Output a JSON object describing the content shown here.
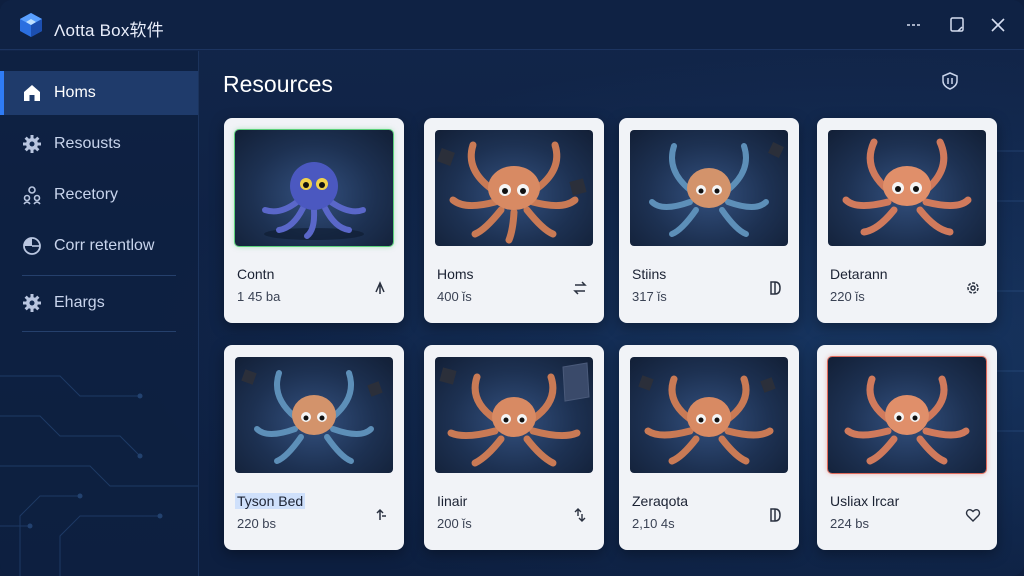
{
  "app": {
    "title": "Λotta Box软件",
    "accent": "#2f7cf6"
  },
  "sidebar": {
    "items": [
      {
        "label": "Homs",
        "icon": "home-icon",
        "active": true
      },
      {
        "label": "Resousts",
        "icon": "gear-icon",
        "active": false
      },
      {
        "label": "Recetory",
        "icon": "users-icon",
        "active": false
      },
      {
        "label": "Corr retentlow",
        "icon": "pie-chart-icon",
        "active": false
      },
      {
        "label": "Ehargs",
        "icon": "gear-icon",
        "active": false
      }
    ]
  },
  "main": {
    "title": "Resources",
    "header_icon": "info-shield-icon",
    "cards": [
      {
        "name": "Contn",
        "size": "1 45 ba",
        "action_icon": "arrow-up-icon",
        "octopus": "blue"
      },
      {
        "name": "Homs",
        "size": "400 ǐs",
        "action_icon": "swap-icon",
        "octopus": "orange"
      },
      {
        "name": "Stiins",
        "size": "317 ǐs",
        "action_icon": "tag-icon",
        "octopus": "teal"
      },
      {
        "name": "Detarann",
        "size": "220 ǐs",
        "action_icon": "settings-icon",
        "octopus": "orange"
      },
      {
        "name": "Tyson Bed",
        "size": "220 bs",
        "action_icon": "arrow-up-bar-icon",
        "octopus": "teal"
      },
      {
        "name": "Iinair",
        "size": "200 ǐs",
        "action_icon": "swap-icon",
        "octopus": "orange"
      },
      {
        "name": "Zeraqota",
        "size": "2,10 4s",
        "action_icon": "tag-icon",
        "octopus": "orange"
      },
      {
        "name": "Usliax lrcar",
        "size": "224 bs",
        "action_icon": "heart-icon",
        "octopus": "orange"
      }
    ]
  }
}
